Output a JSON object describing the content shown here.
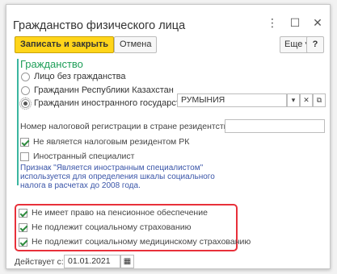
{
  "window": {
    "title": "Гражданство физического лица"
  },
  "toolbar": {
    "save_close": "Записать и закрыть",
    "cancel": "Отмена",
    "more": "Еще ▾",
    "help": "?"
  },
  "citizenship": {
    "group_title": "Гражданство",
    "options": [
      {
        "label": "Лицо без гражданства",
        "checked": false
      },
      {
        "label": "Гражданин Республики Казахстан",
        "checked": false
      },
      {
        "label": "Гражданин иностранного государства",
        "checked": true
      }
    ],
    "country_value": "РУМЫНИЯ"
  },
  "tax": {
    "reg_number_label": "Номер налоговой регистрации в стране резидентства:",
    "reg_number_value": ""
  },
  "flags": {
    "not_tax_resident": {
      "label": "Не является налоговым резидентом РК",
      "checked": true
    },
    "foreign_specialist": {
      "label": "Иностранный специалист",
      "checked": false
    }
  },
  "note": "Признак \"Является иностранным специалистом\" используется для определения шкалы социального налога в расчетах до 2008 года.",
  "insurance": {
    "no_pension": {
      "label": "Не имеет право на пенсионное обеспечение",
      "checked": true
    },
    "no_social": {
      "label": "Не подлежит социальному страхованию",
      "checked": true
    },
    "no_medical": {
      "label": "Не подлежит социальному медицинскому страхованию",
      "checked": true
    }
  },
  "valid_from": {
    "label": "Действует с:",
    "value": "01.01.2021"
  }
}
